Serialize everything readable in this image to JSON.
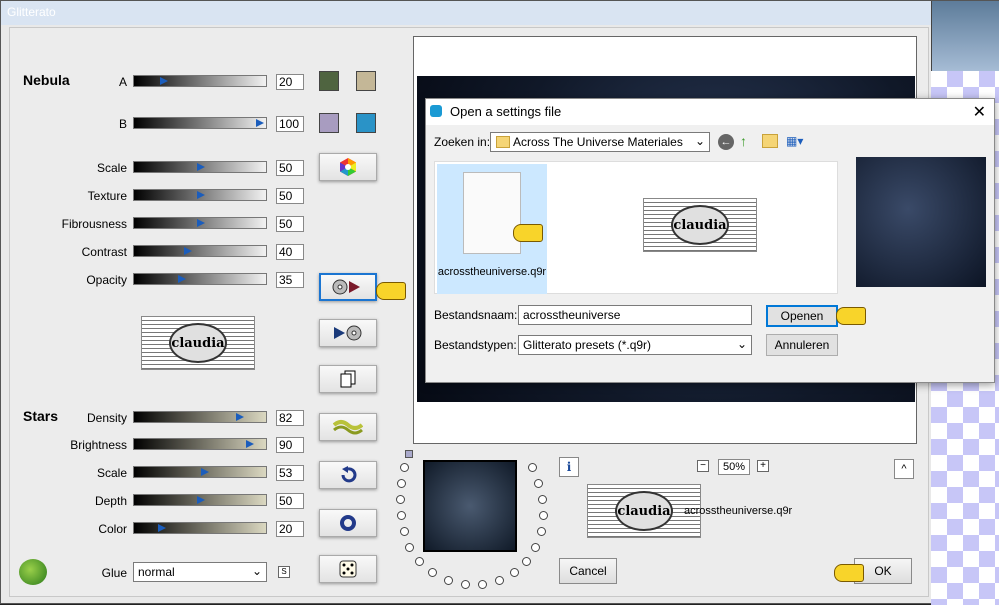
{
  "window": {
    "title": "Glitterato"
  },
  "nebula": {
    "title": "Nebula",
    "a": {
      "label": "A",
      "value": "20"
    },
    "b": {
      "label": "B",
      "value": "100"
    },
    "rows": [
      {
        "label": "Scale",
        "value": "50"
      },
      {
        "label": "Texture",
        "value": "50"
      },
      {
        "label": "Fibrousness",
        "value": "50"
      },
      {
        "label": "Contrast",
        "value": "40"
      },
      {
        "label": "Opacity",
        "value": "35"
      }
    ],
    "colors": {
      "a1": "#4f6440",
      "a2": "#c4b797",
      "b1": "#a89cc0",
      "b2": "#2a93c7"
    }
  },
  "stars": {
    "title": "Stars",
    "rows": [
      {
        "label": "Density",
        "value": "82"
      },
      {
        "label": "Brightness",
        "value": "90"
      },
      {
        "label": "Scale",
        "value": "53"
      },
      {
        "label": "Depth",
        "value": "50"
      },
      {
        "label": "Color",
        "value": "20"
      }
    ]
  },
  "glue": {
    "label": "Glue",
    "value": "normal",
    "s_label": "S"
  },
  "watermark": {
    "text": "claudia"
  },
  "dialog": {
    "title": "Open a settings file",
    "lookin_label": "Zoeken in:",
    "lookin_value": "Across The Universe Materiales",
    "file_name_display": "acrosstheuniverse.q9r",
    "filename_label": "Bestandsnaam:",
    "filename_value": "acrosstheuniverse",
    "filetype_label": "Bestandstypen:",
    "filetype_value": "Glitterato presets (*.q9r)",
    "open_label": "Openen",
    "cancel_label": "Annuleren"
  },
  "bottom": {
    "zoom": "50%",
    "zoom_minus": "−",
    "zoom_plus": "+",
    "preset_name": "acrosstheuniverse.q9r",
    "cancel_label": "Cancel",
    "ok_label": "OK",
    "info_label": "i",
    "up_label": "^"
  }
}
